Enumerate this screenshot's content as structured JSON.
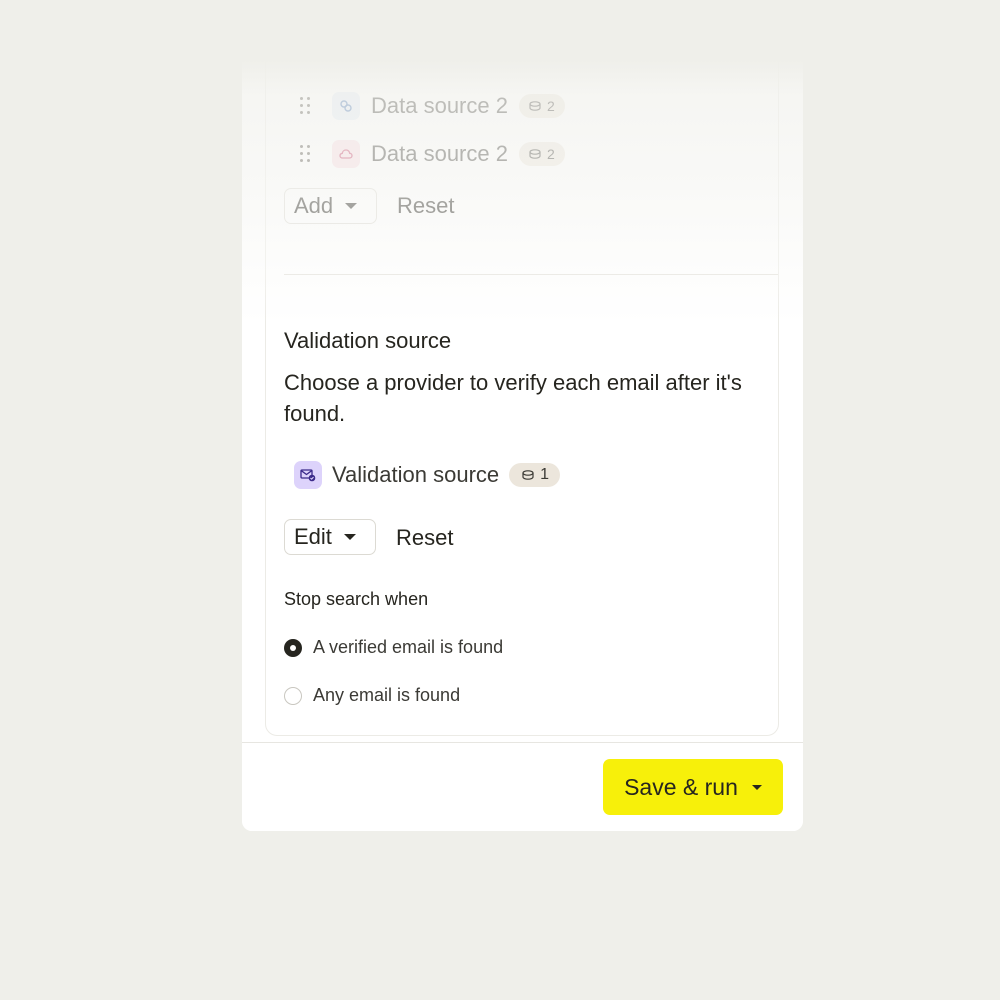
{
  "data_sources": {
    "items": [
      {
        "label": "Data source 2",
        "credits": "2",
        "icon": "link-icon",
        "icon_bg": "#e3ecf7",
        "icon_color": "#3f6fb0"
      },
      {
        "label": "Data source 2",
        "credits": "2",
        "icon": "cloud-icon",
        "icon_bg": "#f9dbe3",
        "icon_color": "#c43a63"
      }
    ],
    "add_label": "Add",
    "reset_label": "Reset"
  },
  "validation": {
    "title": "Validation source",
    "description": "Choose a provider to verify each email after it's found.",
    "source_label": "Validation source",
    "source_credits": "1",
    "source_icon": "mail-check-icon",
    "source_icon_bg": "#ddd3fb",
    "source_icon_color": "#3b2a8a",
    "edit_label": "Edit",
    "reset_label": "Reset"
  },
  "stop_search": {
    "heading": "Stop search when",
    "options": [
      {
        "label": "A verified email is found",
        "selected": true
      },
      {
        "label": "Any email is found",
        "selected": false
      }
    ]
  },
  "footer": {
    "save_label": "Save & run"
  },
  "colors": {
    "accent": "#f7f00a",
    "badge_bg": "#ece6dc",
    "page_bg": "#efefea"
  }
}
